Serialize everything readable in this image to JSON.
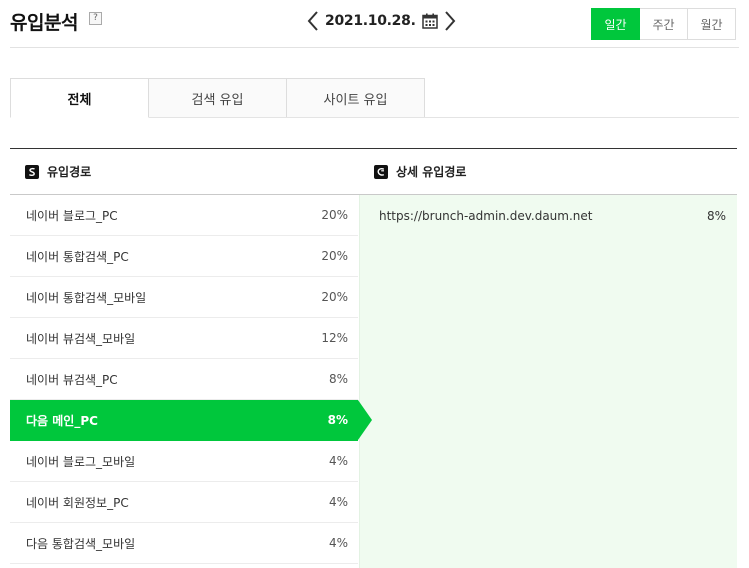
{
  "header": {
    "title": "유입분석",
    "help": "?",
    "date": "2021.10.28.",
    "period_tabs": [
      "일간",
      "주간",
      "월간"
    ]
  },
  "tabs": [
    "전체",
    "검색 유입",
    "사이트 유입"
  ],
  "columns": {
    "left": "유입경로",
    "right": "상세 유입경로"
  },
  "rows": [
    {
      "label": "네이버 블로그_PC",
      "pct": "20%"
    },
    {
      "label": "네이버 통합검색_PC",
      "pct": "20%"
    },
    {
      "label": "네이버 통합검색_모바일",
      "pct": "20%"
    },
    {
      "label": "네이버 뷰검색_모바일",
      "pct": "12%"
    },
    {
      "label": "네이버 뷰검색_PC",
      "pct": "8%"
    },
    {
      "label": "다음 메인_PC",
      "pct": "8%"
    },
    {
      "label": "네이버 블로그_모바일",
      "pct": "4%"
    },
    {
      "label": "네이버 회원정보_PC",
      "pct": "4%"
    },
    {
      "label": "다음 통합검색_모바일",
      "pct": "4%"
    }
  ],
  "detail": [
    {
      "url": "https://brunch-admin.dev.daum.net",
      "pct": "8%"
    }
  ],
  "accent_color": "#00c73c",
  "detail_bg": "#f0fbf0",
  "icons": [
    "help-icon",
    "chevron-left-icon",
    "calendar-icon",
    "chevron-right-icon",
    "source-icon",
    "detail-source-icon"
  ]
}
